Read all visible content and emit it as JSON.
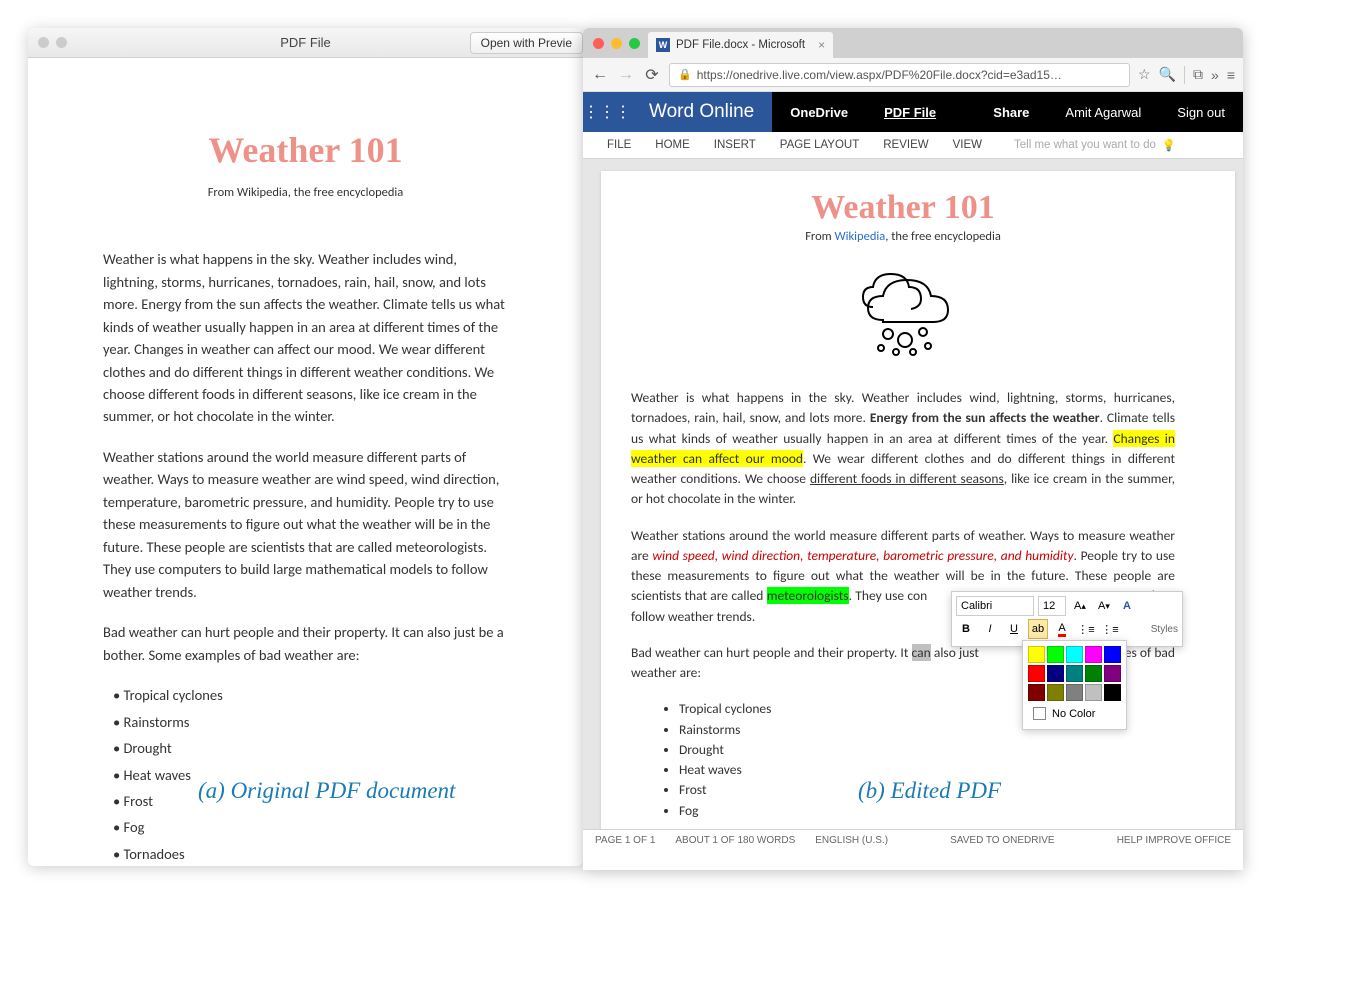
{
  "mac": {
    "title": "PDF File",
    "open_btn": "Open with Previe",
    "doc": {
      "title": "Weather 101",
      "subtitle": "From Wikipedia, the free encyclopedia",
      "p1": "Weather is what happens in the sky. Weather includes wind, lightning, storms, hurricanes, tornadoes, rain, hail, snow, and lots more. Energy from the sun affects the weather. Climate tells us what kinds of weather usually happen in an area at different times of the year. Changes in weather can affect our mood. We wear different clothes and do different things in different weather conditions. We choose different foods in different seasons, like ice cream in the summer, or hot chocolate in the winter.",
      "p2": "Weather stations around the world measure different parts of weather. Ways to measure weather are wind speed, wind direction, temperature, barometric pressure, and humidity. People try to use these measurements to figure out what the weather will be in the future. These people are scientists that are called meteorologists. They use computers to build large mathematical models to follow weather trends.",
      "p3": "Bad weather can hurt people and their property. It can also just be a bother. Some examples of bad weather are:",
      "list": [
        "Tropical cyclones",
        "Rainstorms",
        "Drought",
        "Heat waves",
        "Frost",
        "Fog",
        "Tornadoes"
      ]
    }
  },
  "chrome": {
    "tab_title": "PDF File.docx - Microsoft ",
    "url": "https://onedrive.live.com/view.aspx/PDF%20File.docx?cid=e3ad15…"
  },
  "word": {
    "brand": "Word Online",
    "nav_onedrive": "OneDrive",
    "nav_filename": "PDF File",
    "share": "Share",
    "user": "Amit Agarwal",
    "signout": "Sign out",
    "ribbon": [
      "FILE",
      "HOME",
      "INSERT",
      "PAGE LAYOUT",
      "REVIEW",
      "VIEW"
    ],
    "tellme": "Tell me what you want to do",
    "status": {
      "page": "PAGE 1 OF 1",
      "words": "ABOUT 1 OF 180 WORDS",
      "lang": "ENGLISH (U.S.)",
      "saved": "SAVED TO ONEDRIVE",
      "help": "HELP IMPROVE OFFICE"
    },
    "doc": {
      "title": "Weather 101",
      "sub_from": "From ",
      "sub_link": "Wikipedia",
      "sub_after": ", the free encyclopedia",
      "p1_a": "Weather is what happens in the sky. Weather includes wind, lightning, storms, hurricanes, tornadoes, rain, hail, snow, and lots more. ",
      "p1_bold": "Energy from the sun affects the weather",
      "p1_b": ". Climate tells us what kinds of weather usually happen in an area at different times of the year. ",
      "p1_hl": "Changes in weather can affect our mood",
      "p1_c": ". We wear different clothes and do different things in different weather conditions. We choose ",
      "p1_u": "different foods in different seasons",
      "p1_d": ", like ice cream in the summer, or hot chocolate in the winter.",
      "p2_a": "Weather stations around the world measure different parts of weather. Ways to measure weather are ",
      "p2_red": "wind speed, wind direction, temperature, barometric pressure, and humidity",
      "p2_b": ". People try to use these measurements to figure out what the weather will be in the future. These people are scientists that are called ",
      "p2_green": "meteorologists",
      "p2_c": ". They use con",
      "p2_c2": "els to follow weather trends.",
      "p3_a": "Bad weather can hurt people and their property. It ",
      "p3_sel": "can",
      "p3_b": " also just",
      "p3_c": "e examples of bad weather are:",
      "list": [
        "Tropical cyclones",
        "Rainstorms",
        "Drought",
        "Heat waves",
        "Frost",
        "Fog"
      ]
    },
    "mini": {
      "font": "Calibri",
      "size": "12",
      "styles": "Styles",
      "nocolor": "No Color"
    }
  },
  "annot": {
    "a": "(a) Original PDF document",
    "b": "(b) Edited PDF"
  },
  "colors": {
    "row1": [
      "#ffff00",
      "#00ff00",
      "#00ffff",
      "#ff00ff",
      "#0000ff"
    ],
    "row2": [
      "#ff0000",
      "#000080",
      "#008080",
      "#008000",
      "#800080"
    ],
    "row3": [
      "#800000",
      "#808000",
      "#808080",
      "#c0c0c0",
      "#000000"
    ]
  }
}
